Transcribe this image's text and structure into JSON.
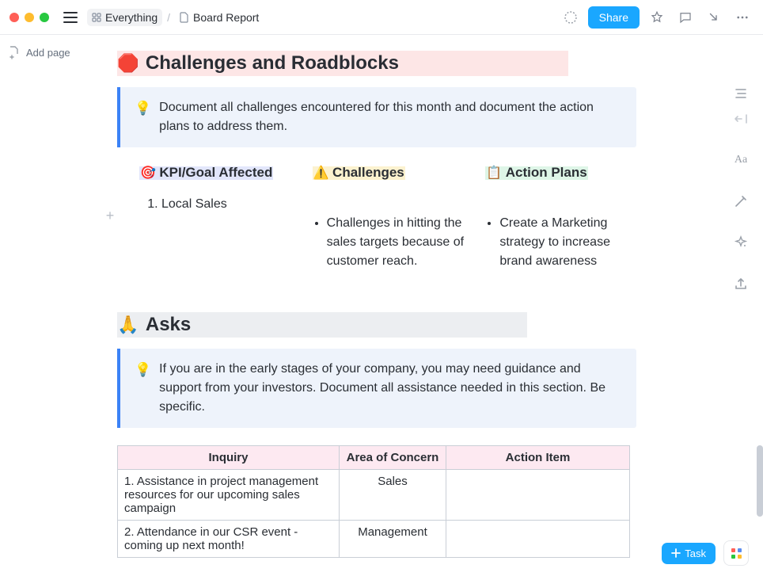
{
  "topbar": {
    "breadcrumb_root": "Everything",
    "breadcrumb_page": "Board Report",
    "share_label": "Share"
  },
  "sidebar": {
    "add_page_label": "Add page"
  },
  "section_challenges": {
    "emoji": "🛑",
    "title": "Challenges and Roadblocks",
    "callout_icon": "💡",
    "callout_text": "Document all challenges encountered for this month and document the action plans to address them.",
    "columns": {
      "kpi": {
        "emoji": "🎯",
        "title": "KPI/Goal Affected",
        "item": "Local Sales"
      },
      "challenges": {
        "emoji": "⚠️",
        "title": "Challenges",
        "item": "Challenges in hitting the sales targets because of customer reach."
      },
      "actions": {
        "emoji": "📋",
        "title": "Action Plans",
        "item": "Create a Marketing strategy to increase brand awareness"
      }
    }
  },
  "section_asks": {
    "emoji": "🙏",
    "title": "Asks",
    "callout_icon": "💡",
    "callout_text": "If you are in the early stages of your company, you may need guidance and support from your investors. Document all assistance needed in this section. Be specific.",
    "table": {
      "headers": {
        "inquiry": "Inquiry",
        "area": "Area of Concern",
        "action": "Action Item"
      },
      "rows": [
        {
          "inquiry": "1. Assistance in project management resources for our upcoming sales campaign",
          "area": "Sales",
          "action": ""
        },
        {
          "inquiry": "2. Attendance in our CSR event - coming up next month!",
          "area": "Management",
          "action": ""
        }
      ]
    }
  },
  "right_rail": {
    "text_style": "Aa"
  },
  "fab": {
    "task_label": "Task"
  }
}
